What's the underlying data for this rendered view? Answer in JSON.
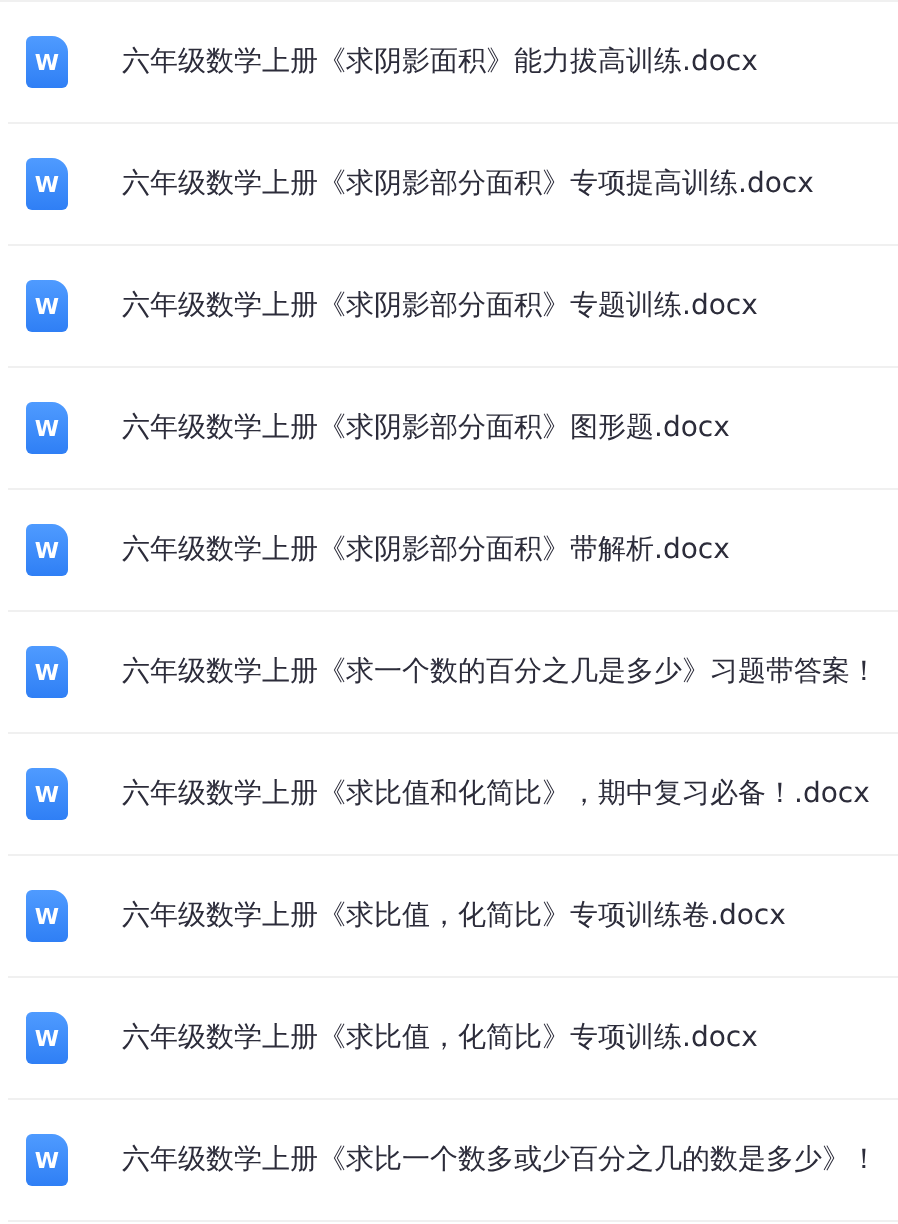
{
  "files": [
    {
      "name": "六年级数学上册《求阴影面积》能力拔高训练.docx",
      "icon_letter": "W"
    },
    {
      "name": "六年级数学上册《求阴影部分面积》专项提高训练.docx",
      "icon_letter": "W"
    },
    {
      "name": "六年级数学上册《求阴影部分面积》专题训练.docx",
      "icon_letter": "W"
    },
    {
      "name": "六年级数学上册《求阴影部分面积》图形题.docx",
      "icon_letter": "W"
    },
    {
      "name": "六年级数学上册《求阴影部分面积》带解析.docx",
      "icon_letter": "W"
    },
    {
      "name": "六年级数学上册《求一个数的百分之几是多少》习题带答案！",
      "icon_letter": "W"
    },
    {
      "name": "六年级数学上册《求比值和化简比》，期中复习必备！.docx",
      "icon_letter": "W"
    },
    {
      "name": "六年级数学上册《求比值，化简比》专项训练卷.docx",
      "icon_letter": "W"
    },
    {
      "name": "六年级数学上册《求比值，化简比》专项训练.docx",
      "icon_letter": "W"
    },
    {
      "name": "六年级数学上册《求比一个数多或少百分之几的数是多少》！",
      "icon_letter": "W"
    }
  ]
}
